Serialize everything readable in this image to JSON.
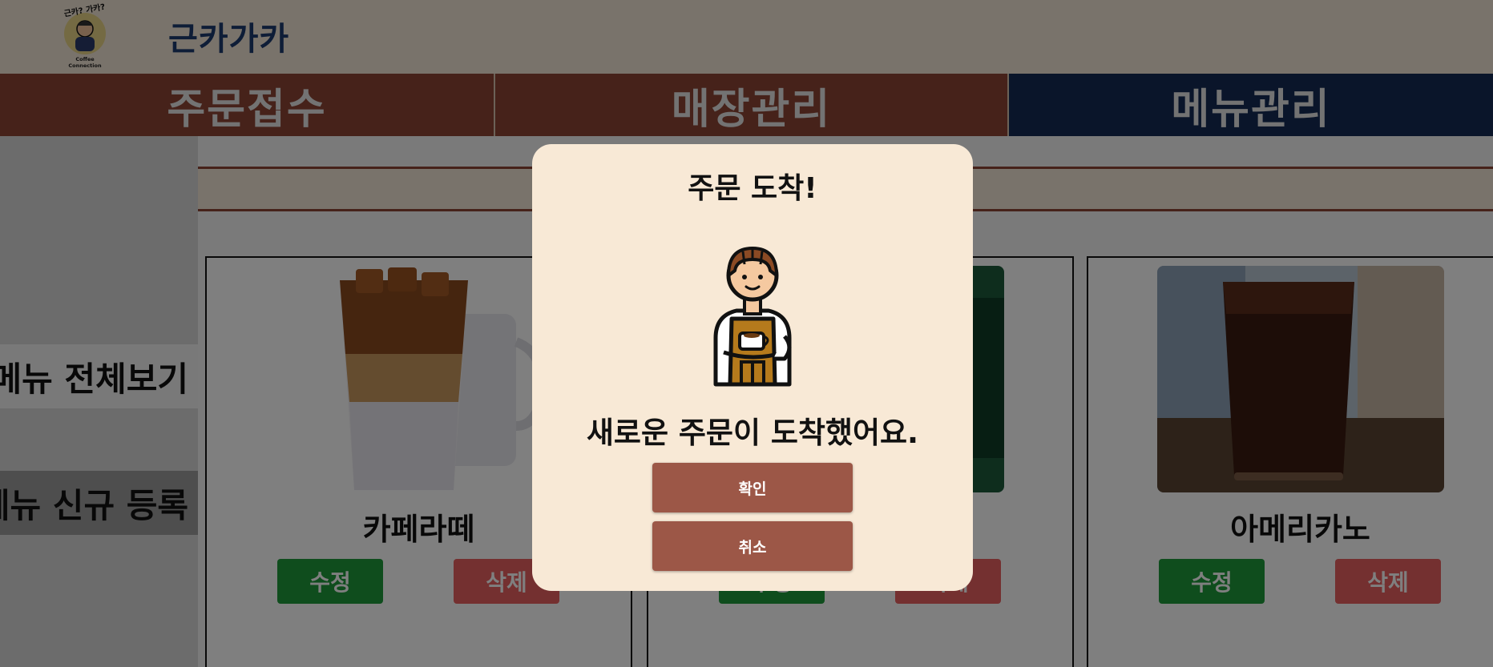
{
  "brand": {
    "name": "근카가카",
    "logo_top_text": "근카? 가카?",
    "logo_bottom_text": "Coffee Connection"
  },
  "tabs": [
    {
      "label": "주문접수"
    },
    {
      "label": "매장관리"
    },
    {
      "label": "메뉴관리"
    }
  ],
  "sidebar": {
    "items": [
      {
        "label": "메뉴 전체보기"
      },
      {
        "label": "메뉴 신규 등록"
      }
    ]
  },
  "menu_cards": [
    {
      "name": "카페라떼",
      "edit_label": "수정",
      "delete_label": "삭제",
      "image_icon": "iced-latte-image"
    },
    {
      "name": "",
      "edit_label": "수정",
      "delete_label": "삭제",
      "image_icon": "drink-image"
    },
    {
      "name": "아메리카노",
      "edit_label": "수정",
      "delete_label": "삭제",
      "image_icon": "iced-americano-image"
    }
  ],
  "modal": {
    "title": "주문 도착!",
    "message": "새로운 주문이 도착했어요.",
    "confirm_label": "확인",
    "cancel_label": "취소",
    "icon": "barista-icon"
  },
  "colors": {
    "header_bg": "#f3e6d6",
    "tab_brown": "#8c4535",
    "tab_navy": "#142a55",
    "brand_text": "#1d3b6e",
    "modal_bg": "#f8e9d6",
    "modal_button": "#9c5747",
    "edit_green": "#1e9a3a",
    "delete_red": "#e86060"
  }
}
